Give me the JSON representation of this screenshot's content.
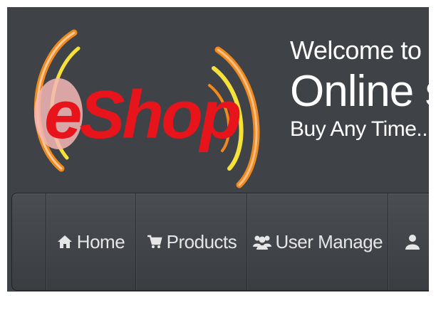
{
  "brand": {
    "logo_text": "eShop"
  },
  "welcome": {
    "line1": "Welcome to",
    "line2": "Online sh",
    "line3": "Buy Any Time..."
  },
  "nav": {
    "items": [
      {
        "label": "Home",
        "icon": "home-icon"
      },
      {
        "label": "Products",
        "icon": "cart-icon"
      },
      {
        "label": "User Manage",
        "icon": "users-icon"
      },
      {
        "label": "",
        "icon": "user-icon"
      }
    ]
  },
  "colors": {
    "background": "#3f4246",
    "logo_red": "#e8141c",
    "arc_orange": "#f08a1e",
    "arc_yellow": "#f6e13a",
    "text": "#ffffff"
  }
}
